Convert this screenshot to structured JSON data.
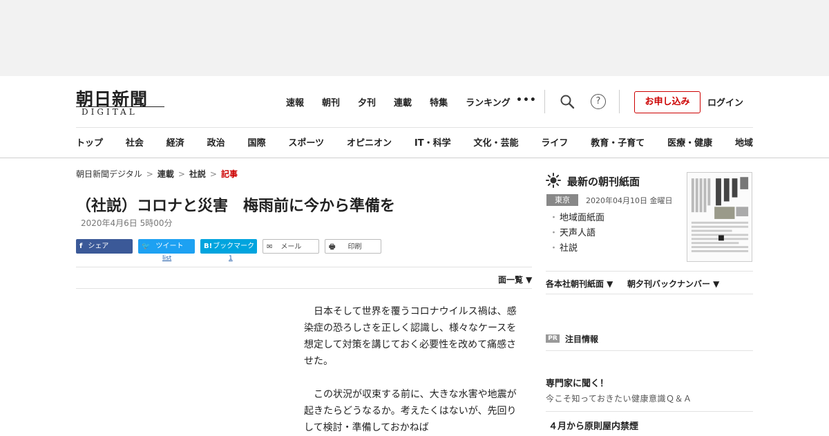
{
  "logo": {
    "main": "朝日新聞",
    "sub": "DIGITAL"
  },
  "topnav": [
    "速報",
    "朝刊",
    "夕刊",
    "連載",
    "特集",
    "ランキング"
  ],
  "more": "•••",
  "header_actions": {
    "help": "?",
    "apply": "お申し込み",
    "login": "ログイン"
  },
  "catnav": [
    "トップ",
    "社会",
    "経済",
    "政治",
    "国際",
    "スポーツ",
    "オピニオン",
    "IT・科学",
    "文化・芸能",
    "ライフ",
    "教育・子育て",
    "医療・健康",
    "地域"
  ],
  "breadcrumb": {
    "root": "朝日新聞デジタル",
    "section": "連載",
    "sub": "社説",
    "current": "記事",
    "sep": ">"
  },
  "article": {
    "title": "（社説）コロナと災害　梅雨前に今から準備を",
    "date": "2020年4月6日 5時00分",
    "paragraphs": [
      "　日本そして世界を覆うコロナウイルス禍は、感染症の恐ろしさを正しく認識し、様々なケースを想定して対策を講じておく必要性を改めて痛感させた。",
      "　この状況が収束する前に、大きな水害や地震が起きたらどうなるか。考えたくはないが、先回りして検討・準備しておかねば"
    ]
  },
  "share": {
    "facebook": "シェア",
    "twitter": "ツイート",
    "hatena": "ブックマーク",
    "hatena_icon": "B!",
    "mail": "メール",
    "print": "印刷",
    "twitter_count": "list",
    "hatena_count": "1"
  },
  "menscope": "面一覧 ▼",
  "sidebar": {
    "heading": "最新の朝刊紙面",
    "region": "東京",
    "paper_date": "2020年04月10日 金曜日",
    "links": [
      "地域面紙面",
      "天声人語",
      "社説"
    ],
    "dropdown1": "各本社朝刊紙面 ▼",
    "dropdown2": "朝夕刊バックナンバー ▼",
    "pr_badge": "PR",
    "pr_label": "注目情報",
    "feature_title": "専門家に聞く！",
    "feature_sub": "今こそ知っておきたい健康意識Ｑ＆Ａ",
    "feature2": "４月から原則屋内禁煙"
  },
  "colors": {
    "accent": "#cc0000",
    "facebook": "#3b5998",
    "twitter": "#1da1f2",
    "hatena": "#00a4de"
  }
}
